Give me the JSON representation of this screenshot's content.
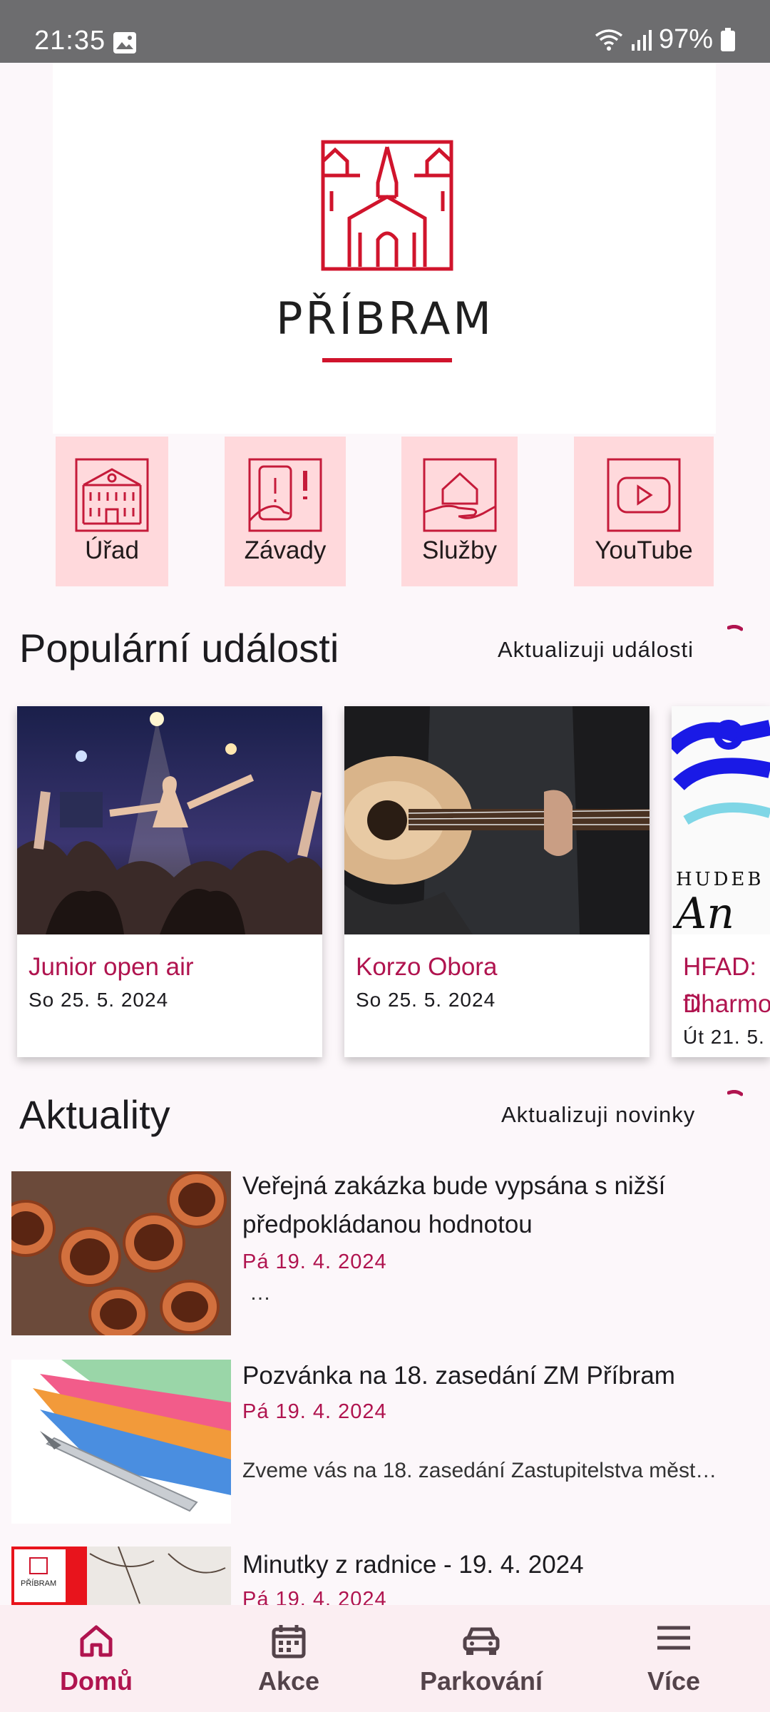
{
  "status_bar": {
    "time": "21:35",
    "battery": "97%"
  },
  "header": {
    "brand": "PŘÍBRAM"
  },
  "tiles": [
    {
      "label": "Úřad",
      "icon": "town-hall-icon"
    },
    {
      "label": "Závady",
      "icon": "report-issue-icon"
    },
    {
      "label": "Služby",
      "icon": "services-icon"
    },
    {
      "label": "YouTube",
      "icon": "youtube-icon"
    }
  ],
  "events_section": {
    "title": "Populární události",
    "action": "Aktualizuji události"
  },
  "events": [
    {
      "title": "Junior open air",
      "date": "So 25. 5. 2024"
    },
    {
      "title": "Korzo Obora",
      "date": "So 25. 5. 2024"
    },
    {
      "title": "HFAD: D",
      "title2": "filharmo",
      "date": "Út 21. 5.",
      "poster_text": "HUDEB",
      "poster_text2": "An"
    }
  ],
  "news_section": {
    "title": "Aktuality",
    "action": "Aktualizuji novinky"
  },
  "news": [
    {
      "title": "Veřejná zakázka bude vypsána s nižší předpokládanou hodnotou",
      "date": "Pá 19. 4. 2024",
      "excerpt": "…"
    },
    {
      "title": "Pozvánka na 18. zasedání ZM Příbram",
      "date": "Pá 19. 4. 2024",
      "excerpt": "Zveme vás na 18. zasedání Zastupitelstva měst…"
    },
    {
      "title": "Minutky z radnice - 19. 4. 2024",
      "date": "Pá 19. 4. 2024",
      "excerpt": "",
      "thumb_text": "PŘÍBRAM"
    }
  ],
  "bottom_nav": [
    {
      "label": "Domů",
      "icon": "home-icon",
      "active": true
    },
    {
      "label": "Akce",
      "icon": "calendar-icon",
      "active": false
    },
    {
      "label": "Parkování",
      "icon": "car-icon",
      "active": false
    },
    {
      "label": "Více",
      "icon": "menu-icon",
      "active": false
    }
  ],
  "colors": {
    "accent": "#b0144f",
    "brand_red": "#d0142c",
    "tile_bg": "#ffd9dc"
  }
}
